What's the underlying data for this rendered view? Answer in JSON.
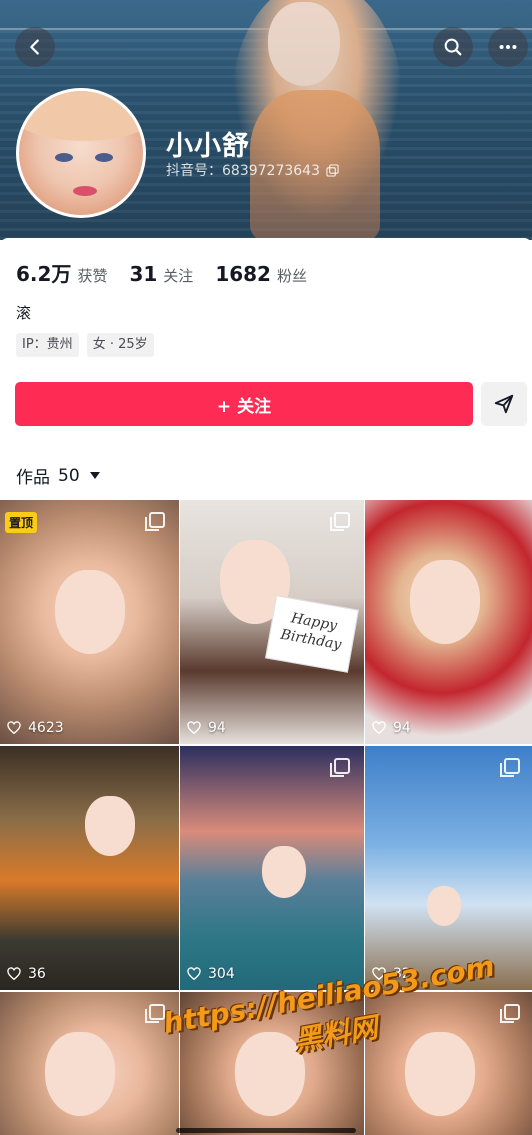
{
  "profile": {
    "nickname": "小小舒",
    "douyin_id": "抖音号：68397273643",
    "bio": "滚",
    "tags": [
      "IP：贵州",
      "女 · 25岁"
    ]
  },
  "stats": [
    {
      "value": "6.2万",
      "label": "获赞"
    },
    {
      "value": "31",
      "label": "关注"
    },
    {
      "value": "1682",
      "label": "粉丝"
    }
  ],
  "actions": {
    "follow_label": "+ 关注"
  },
  "works": {
    "label": "作品",
    "count": "50"
  },
  "grid": [
    {
      "likes": "4623",
      "pinned": "置顶",
      "multi": true
    },
    {
      "likes": "94",
      "pinned": "",
      "multi": true
    },
    {
      "likes": "94",
      "pinned": "",
      "multi": false
    },
    {
      "likes": "36",
      "pinned": "",
      "multi": false
    },
    {
      "likes": "304",
      "pinned": "",
      "multi": true
    },
    {
      "likes": "32",
      "pinned": "",
      "multi": true
    },
    {
      "likes": "",
      "pinned": "",
      "multi": true
    },
    {
      "likes": "",
      "pinned": "",
      "multi": false
    },
    {
      "likes": "",
      "pinned": "",
      "multi": true
    }
  ],
  "overlay": {
    "card_text": "Happy Birthday",
    "watermark_url": "https://heiliao53.com",
    "watermark_cn": "黑料网"
  },
  "colors": {
    "accent": "#fe2c55",
    "pin_badge": "#facc15"
  },
  "icons": [
    "back-icon",
    "search-icon",
    "more-icon",
    "copy-icon",
    "share-icon",
    "heart-icon",
    "multi-image-icon"
  ]
}
